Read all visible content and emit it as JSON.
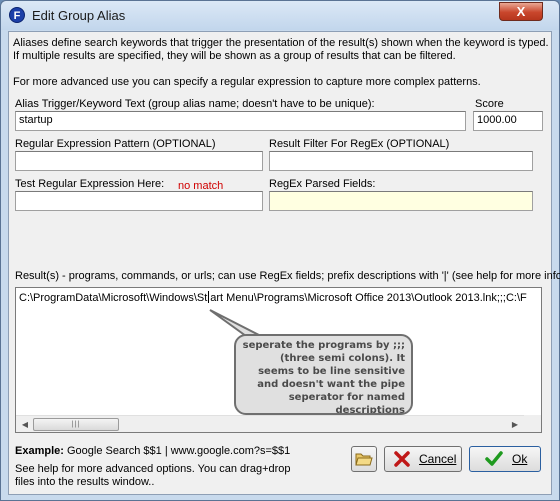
{
  "window": {
    "title": "Edit Group Alias",
    "app_icon": "F",
    "close_label": "X"
  },
  "intro": {
    "line1": "Aliases define search keywords that trigger the presentation of the result(s) shown when the keyword is typed.",
    "line2": "If multiple results are specified, they will be shown as a group of results that can be filtered.",
    "line3": "For more advanced use you can specify a regular expression to capture more complex patterns."
  },
  "alias": {
    "label": "Alias Trigger/Keyword Text (group alias name; doesn't have to be unique):",
    "value": "startup"
  },
  "score": {
    "label": "Score",
    "value": "1000.00"
  },
  "regex_pattern": {
    "label": "Regular Expression Pattern (OPTIONAL)",
    "value": ""
  },
  "result_filter": {
    "label": "Result Filter For RegEx (OPTIONAL)",
    "value": ""
  },
  "test_regex": {
    "label": "Test Regular Expression Here:",
    "status": "no match",
    "value": ""
  },
  "parsed_fields": {
    "label": "RegEx Parsed Fields:",
    "value": ""
  },
  "results": {
    "label": "Result(s) - programs, commands, or urls; can use RegEx fields; prefix descriptions with '|' (see help for more info)",
    "value_before_caret": "C:\\ProgramData\\Microsoft\\Windows\\St",
    "value_after_caret": "art Menu\\Programs\\Microsoft Office 2013\\Outlook 2013.lnk;;;C:\\F",
    "scroll_thumb_grip": "|||"
  },
  "annotation": {
    "text": "seperate the programs by ;;; (three semi colons). It seems to be line sensitive and doesn't want the pipe seperator for named descriptions"
  },
  "example": {
    "prefix": "Example:",
    "text": "Google Search $$1 | www.google.com?s=$$1"
  },
  "help": {
    "line1": "See help for more advanced options.  You can drag+drop",
    "line2": "files into the results window.."
  },
  "buttons": {
    "cancel_label": "Cancel",
    "ok_label": "Ok"
  },
  "colors": {
    "no_match": "#d00000",
    "parsed_fields_bg": "#ffffe1",
    "close_button": "#c9462c"
  },
  "icons": {
    "app": "app-logo-icon",
    "open": "open-folder-icon",
    "cancel": "red-x-icon",
    "ok": "green-checkmark-icon"
  }
}
